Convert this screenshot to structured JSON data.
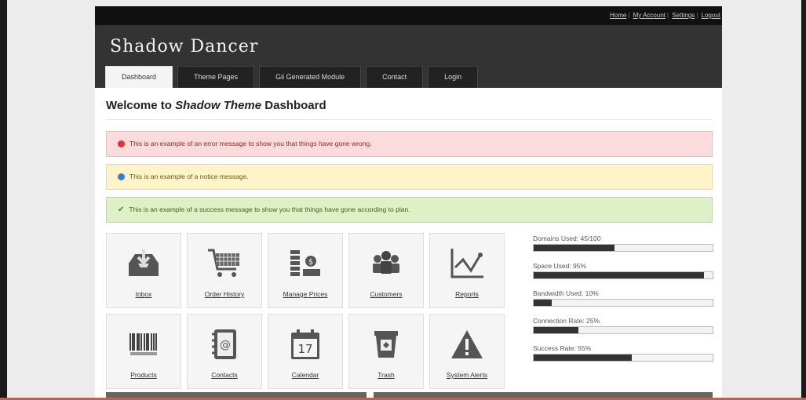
{
  "toplinks": {
    "home": "Home",
    "account": "My Account",
    "settings": "Settings",
    "logout": "Logout"
  },
  "brand": "Shadow Dancer",
  "tabs": [
    "Dashboard",
    "Theme Pages",
    "Gii Generated Module",
    "Contact",
    "Login"
  ],
  "title": {
    "prefix": "Welcome to ",
    "emph": "Shadow Theme",
    "suffix": " Dashboard"
  },
  "messages": {
    "error": "This is an example of an error message to show you that things have gone wrong.",
    "notice": "This is an example of a notice message.",
    "success": "This is an example of a success message to show you that things have gone according to plan."
  },
  "tiles": [
    {
      "label": "Inbox",
      "icon": "inbox-icon"
    },
    {
      "label": "Order History",
      "icon": "cart-icon"
    },
    {
      "label": "Manage Prices",
      "icon": "prices-icon"
    },
    {
      "label": "Customers",
      "icon": "customers-icon"
    },
    {
      "label": "Reports",
      "icon": "chart-icon"
    },
    {
      "label": "Products",
      "icon": "barcode-icon"
    },
    {
      "label": "Contacts",
      "icon": "address-book-icon"
    },
    {
      "label": "Calendar",
      "icon": "calendar-icon",
      "calendar_day": "17"
    },
    {
      "label": "Trash",
      "icon": "trash-icon"
    },
    {
      "label": "System Alerts",
      "icon": "warning-icon"
    }
  ],
  "stats": [
    {
      "label": "Domains Used: 45/100",
      "percent": 45
    },
    {
      "label": "Space Used: 95%",
      "percent": 95
    },
    {
      "label": "Bandwidth Used: 10%",
      "percent": 10
    },
    {
      "label": "Connection Rate: 25%",
      "percent": 25
    },
    {
      "label": "Success Rate: 55%",
      "percent": 55
    }
  ],
  "colors": {
    "header": "#333333",
    "error_bg": "#fbdbdb",
    "notice_bg": "#fdf5c9",
    "success_bg": "#def0c6",
    "bar_fill": "#333333"
  }
}
